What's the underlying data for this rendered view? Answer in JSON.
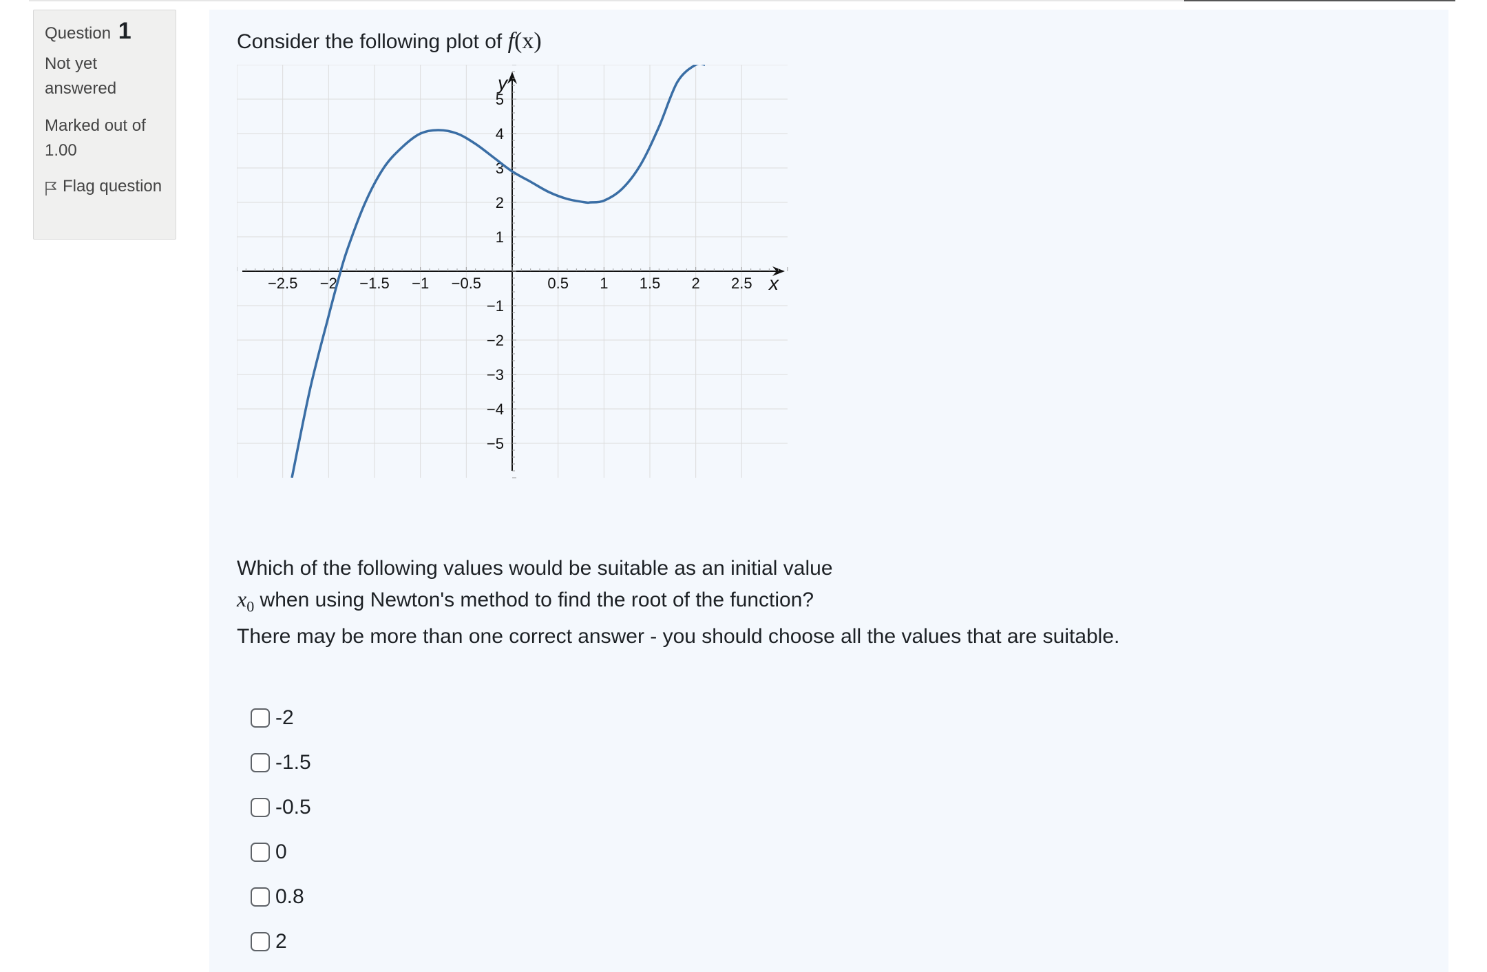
{
  "info": {
    "question_label": "Question",
    "question_number": "1",
    "state": "Not yet answered",
    "grade": "Marked out of 1.00",
    "flag_label": "Flag question",
    "flag_icon": "flag-outline-icon"
  },
  "content": {
    "prompt_text": "Consider the following plot of",
    "prompt_math_f": "f",
    "prompt_math_args": "(x)",
    "question_line1": "Which of the following values would be suitable as an initial value",
    "question_x": "x",
    "question_x_sub": "0",
    "question_line2_rest": "when using Newton's method to find the root of the function?",
    "question_line3": "There may be more than one correct answer - you should choose all the values that are suitable."
  },
  "options": [
    {
      "label": "-2",
      "checked": false
    },
    {
      "label": "-1.5",
      "checked": false
    },
    {
      "label": "-0.5",
      "checked": false
    },
    {
      "label": "0",
      "checked": false
    },
    {
      "label": "0.8",
      "checked": false
    },
    {
      "label": "2",
      "checked": false
    }
  ],
  "colors": {
    "curve": "#3a6ea5",
    "panel_bg": "#f4f8fd",
    "info_bg": "#f0f0ef",
    "grid": "#dcdcdc"
  },
  "chart_data": {
    "type": "line",
    "title": "",
    "xlabel": "x",
    "ylabel": "y",
    "xlim": [
      -3,
      3
    ],
    "ylim": [
      -6,
      6
    ],
    "grid": true,
    "x_ticks": [
      "−2.5",
      "−2",
      "−1.5",
      "−1",
      "−0.5",
      "0.5",
      "1",
      "1.5",
      "2",
      "2.5"
    ],
    "y_ticks": [
      "5",
      "4",
      "3",
      "2",
      "1",
      "−1",
      "−2",
      "−3",
      "−4",
      "−5"
    ],
    "x_tick_values": [
      -2.5,
      -2,
      -1.5,
      -1,
      -0.5,
      0.5,
      1,
      1.5,
      2,
      2.5
    ],
    "y_tick_values": [
      5,
      4,
      3,
      2,
      1,
      -1,
      -2,
      -3,
      -4,
      -5
    ],
    "series": [
      {
        "x": [
          -2.4,
          -2.2,
          -2.0,
          -1.9,
          -1.8,
          -1.6,
          -1.4,
          -1.2,
          -1.0,
          -0.8,
          -0.6,
          -0.4,
          -0.2,
          0.0,
          0.2,
          0.4,
          0.6,
          0.8,
          0.85,
          1.0,
          1.2,
          1.4,
          1.6,
          1.8,
          2.0,
          2.1
        ],
        "y": [
          -6.0,
          -3.4,
          -1.3,
          -0.3,
          0.6,
          2.0,
          3.0,
          3.6,
          4.0,
          4.1,
          4.0,
          3.7,
          3.3,
          2.9,
          2.6,
          2.3,
          2.1,
          2.0,
          2.0,
          2.05,
          2.4,
          3.1,
          4.2,
          5.5,
          6.0,
          6.0
        ]
      }
    ]
  }
}
